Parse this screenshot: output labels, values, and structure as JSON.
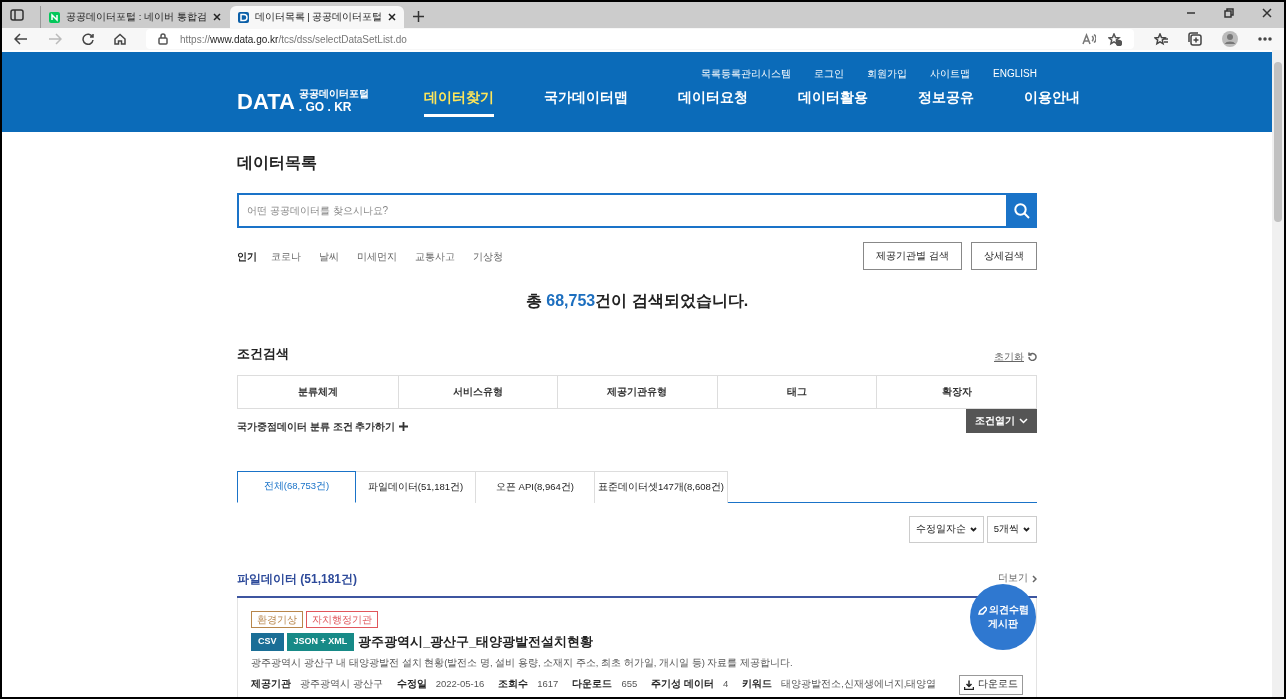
{
  "browser": {
    "tabs": [
      {
        "title": "공공데이터포털 : 네이버 통합검",
        "kind": "naver",
        "selected": false
      },
      {
        "title": "데이터목록 | 공공데이터포털",
        "kind": "data",
        "selected": true
      }
    ],
    "url": {
      "scheme": "https://",
      "host": "www.data.go.kr",
      "path": "/tcs/dss/selectDataSetList.do"
    }
  },
  "header": {
    "utility_links": [
      "목록등록관리시스템",
      "로그인",
      "회원가입",
      "사이트맵",
      "ENGLISH"
    ],
    "logo": {
      "main": "DATA",
      "sub": "공공데이터포털",
      "domain": ". GO . KR"
    },
    "nav": [
      {
        "label": "데이터찾기",
        "selected": true
      },
      {
        "label": "국가데이터맵",
        "selected": false
      },
      {
        "label": "데이터요청",
        "selected": false
      },
      {
        "label": "데이터활용",
        "selected": false
      },
      {
        "label": "정보공유",
        "selected": false
      },
      {
        "label": "이용안내",
        "selected": false
      }
    ]
  },
  "page_title": "데이터목록",
  "search": {
    "placeholder": "어떤 공공데이터를 찾으시나요?"
  },
  "popular": {
    "label": "인기",
    "keywords": [
      "코로나",
      "날씨",
      "미세먼지",
      "교통사고",
      "기상청"
    ]
  },
  "search_buttons": [
    "제공기관별 검색",
    "상세검색"
  ],
  "result_summary": {
    "prefix": "총",
    "count": "68,753",
    "suffix": "건이 검색되었습니다."
  },
  "filters": {
    "title": "조건검색",
    "reset": "초기화",
    "columns": [
      "분류체계",
      "서비스유형",
      "제공기관유형",
      "태그",
      "확장자"
    ],
    "add_condition": "국가중점데이터 분류 조건 추가하기",
    "open_button": "조건열기"
  },
  "result_tabs": [
    {
      "label": "전체(68,753건)",
      "selected": true
    },
    {
      "label": "파일데이터(51,181건)",
      "selected": false
    },
    {
      "label": "오픈 API(8,964건)",
      "selected": false
    },
    {
      "label": "표준데이터셋147개(8,608건)",
      "selected": false
    }
  ],
  "sort_selects": [
    "수정일자순",
    "5개씩"
  ],
  "section": {
    "title": "파일데이터 (51,181건)",
    "more": "더보기"
  },
  "items": [
    {
      "tags": [
        {
          "label": "환경기상",
          "color": "#b8864b"
        },
        {
          "label": "자치행정기관",
          "color": "#e0565b"
        }
      ],
      "formats": [
        {
          "label": "CSV",
          "color": "#1a6e96"
        },
        {
          "label": "JSON + XML",
          "color": "#178a87"
        }
      ],
      "title": "광주광역시_광산구_태양광발전설치현황",
      "description": "광주광역시 광산구 내 태양광발전 설치 현황(발전소 명, 설비 용량, 소재지 주소, 최초 허가일, 개시일 등) 자료를 제공합니다.",
      "meta": [
        {
          "label": "제공기관",
          "value": "광주광역시 광산구"
        },
        {
          "label": "수정일",
          "value": "2022-05-16"
        },
        {
          "label": "조회수",
          "value": "1617"
        },
        {
          "label": "다운로드",
          "value": "655"
        },
        {
          "label": "주기성 데이터",
          "value": "4"
        },
        {
          "label": "키워드",
          "value": "태양광발전소,신재생에너지,태양열"
        }
      ],
      "download": "다운로드"
    }
  ],
  "floating_button": [
    "의견수렴",
    "게시판"
  ]
}
